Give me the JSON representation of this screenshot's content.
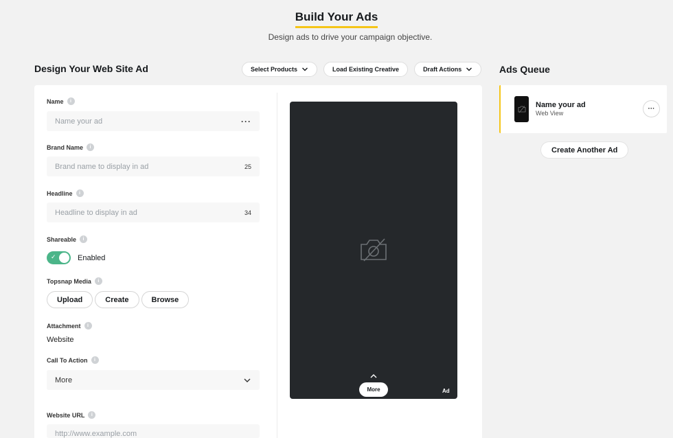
{
  "header": {
    "title": "Build Your Ads",
    "subtitle": "Design ads to drive your campaign objective."
  },
  "editor": {
    "title": "Design Your Web Site Ad",
    "toolbar": {
      "select_products": "Select Products",
      "load_existing": "Load Existing Creative",
      "draft_actions": "Draft Actions"
    },
    "fields": {
      "name": {
        "label": "Name",
        "placeholder": "Name your ad"
      },
      "brand_name": {
        "label": "Brand Name",
        "placeholder": "Brand name to display in ad",
        "count": "25"
      },
      "headline": {
        "label": "Headline",
        "placeholder": "Headline to display in ad",
        "count": "34"
      },
      "shareable": {
        "label": "Shareable",
        "value": "Enabled",
        "enabled": true
      },
      "topsnap_media": {
        "label": "Topsnap Media",
        "upload": "Upload",
        "create": "Create",
        "browse": "Browse"
      },
      "attachment": {
        "label": "Attachment",
        "value": "Website"
      },
      "call_to_action": {
        "label": "Call To Action",
        "value": "More"
      },
      "website_url": {
        "label": "Website URL",
        "placeholder": "http://www.example.com"
      }
    }
  },
  "preview": {
    "more_label": "More",
    "ad_tag": "Ad"
  },
  "queue": {
    "title": "Ads Queue",
    "items": [
      {
        "name": "Name your ad",
        "type": "Web View"
      }
    ],
    "create_another": "Create Another Ad"
  },
  "colors": {
    "accent_yellow": "#f5c518",
    "toggle_green": "#4bb589",
    "phone_bg": "#25282b"
  }
}
